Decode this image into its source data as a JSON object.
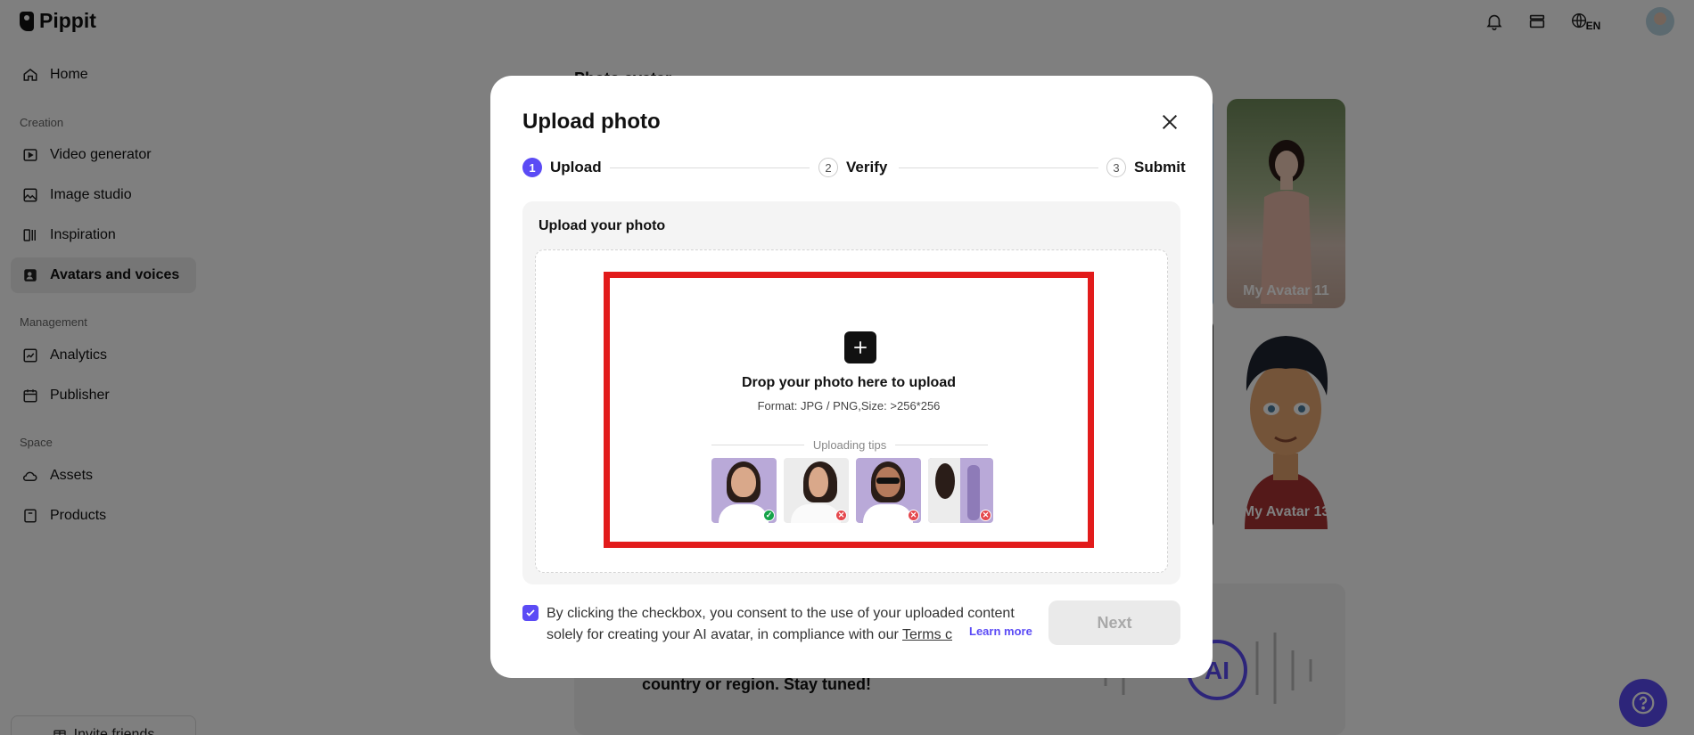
{
  "app": {
    "name": "Pippit"
  },
  "header": {
    "language": "EN"
  },
  "sidebar": {
    "items": [
      {
        "label": "Home",
        "icon": "home-icon"
      },
      {
        "label": "Video generator",
        "icon": "video-icon"
      },
      {
        "label": "Image studio",
        "icon": "image-icon"
      },
      {
        "label": "Inspiration",
        "icon": "inspiration-icon"
      },
      {
        "label": "Avatars and voices",
        "icon": "avatar-icon",
        "active": true
      },
      {
        "label": "Analytics",
        "icon": "analytics-icon"
      },
      {
        "label": "Publisher",
        "icon": "calendar-icon"
      },
      {
        "label": "Assets",
        "icon": "cloud-icon"
      },
      {
        "label": "Products",
        "icon": "products-icon"
      }
    ],
    "sections": [
      "Creation",
      "Management",
      "Space"
    ],
    "invite_label": "Invite friends"
  },
  "main": {
    "title": "Photo avatar",
    "cards": [
      {
        "label": "My Avatar 11"
      },
      {
        "label": "My Avatar 13"
      }
    ],
    "promo_text": "country or region. Stay tuned!",
    "promo_logo": "AI"
  },
  "modal": {
    "title": "Upload photo",
    "steps": [
      {
        "num": "1",
        "label": "Upload",
        "active": true
      },
      {
        "num": "2",
        "label": "Verify",
        "active": false
      },
      {
        "num": "3",
        "label": "Submit",
        "active": false
      }
    ],
    "panel_title": "Upload your photo",
    "drop_title": "Drop your photo here to upload",
    "drop_format": "Format: JPG / PNG,Size: >256*256",
    "tips_label": "Uploading tips",
    "consent_line1": "By clicking the checkbox, you consent to the use of your uploaded content",
    "consent_line2": "solely for creating your AI avatar, in compliance with our ",
    "terms_label": "Terms c",
    "learn_more": "Learn more",
    "next_label": "Next"
  },
  "colors": {
    "accent": "#5b4bf5",
    "highlight": "#e21b1b",
    "ok": "#16a34a",
    "bad": "#e5484d"
  }
}
